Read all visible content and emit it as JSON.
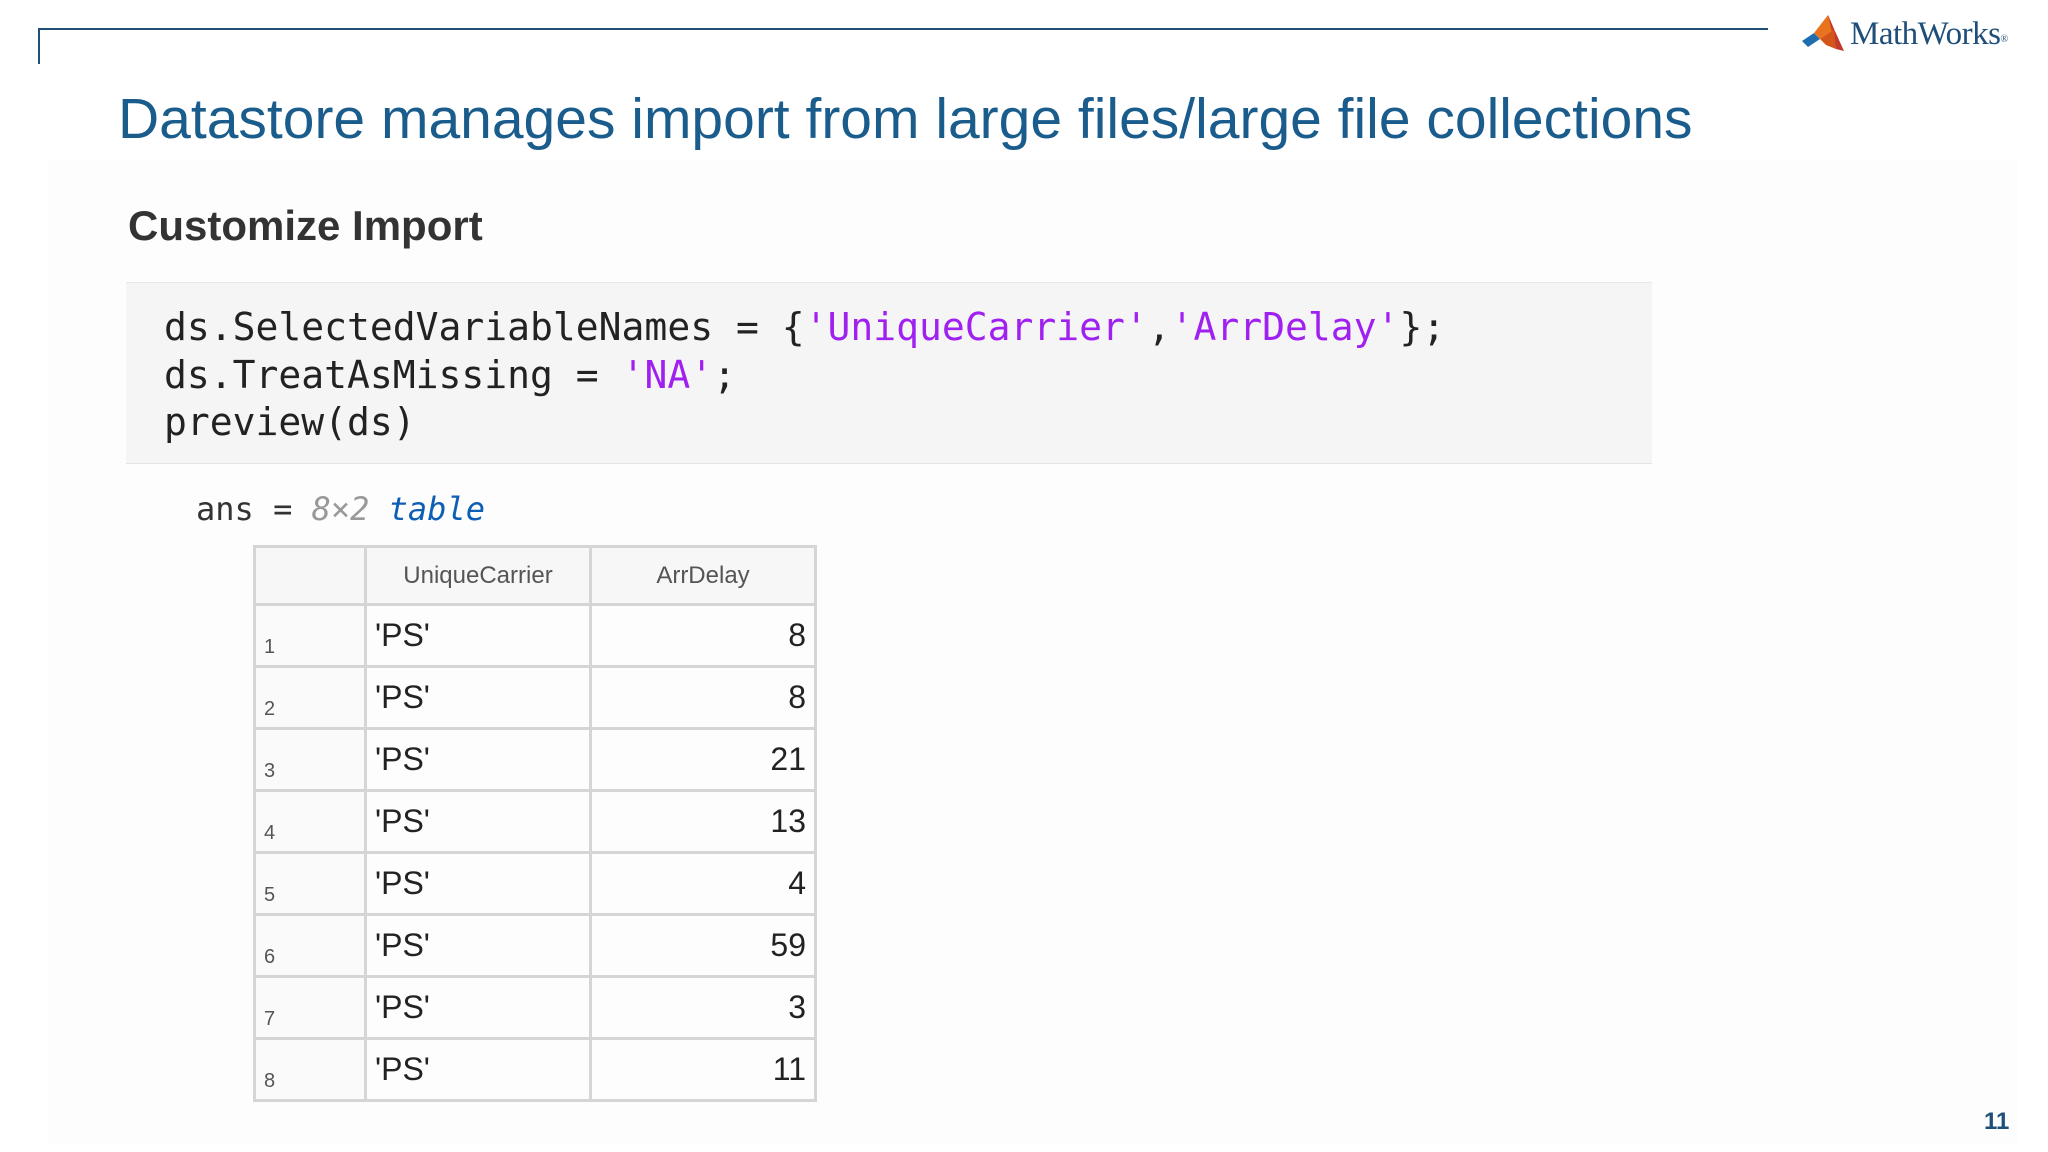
{
  "logo": {
    "text": "MathWorks",
    "mark": "®",
    "icon": "matlab-membrane-icon"
  },
  "title": "Datastore manages import from large files/large file collections",
  "section_heading": "Customize Import",
  "code": {
    "line1": {
      "prefix": "ds.SelectedVariableNames = {",
      "str1": "'UniqueCarrier'",
      "sep": ",",
      "str2": "'ArrDelay'",
      "suffix": "};"
    },
    "line2": {
      "prefix": "ds.TreatAsMissing = ",
      "str1": "'NA'",
      "suffix": ";"
    },
    "line3": {
      "text": "preview(ds)"
    }
  },
  "output": {
    "ans_label": "ans = ",
    "dims": "8×2",
    "class_name": "table"
  },
  "table": {
    "headers": [
      "",
      "UniqueCarrier",
      "ArrDelay"
    ],
    "rows": [
      {
        "idx": "1",
        "carrier": "'PS'",
        "delay": "8"
      },
      {
        "idx": "2",
        "carrier": "'PS'",
        "delay": "8"
      },
      {
        "idx": "3",
        "carrier": "'PS'",
        "delay": "21"
      },
      {
        "idx": "4",
        "carrier": "'PS'",
        "delay": "13"
      },
      {
        "idx": "5",
        "carrier": "'PS'",
        "delay": "4"
      },
      {
        "idx": "6",
        "carrier": "'PS'",
        "delay": "59"
      },
      {
        "idx": "7",
        "carrier": "'PS'",
        "delay": "3"
      },
      {
        "idx": "8",
        "carrier": "'PS'",
        "delay": "11"
      }
    ]
  },
  "page_number": "11",
  "colors": {
    "title": "#1a5c8c",
    "string_literal": "#a020f0",
    "class_link": "#0e5fb3"
  }
}
